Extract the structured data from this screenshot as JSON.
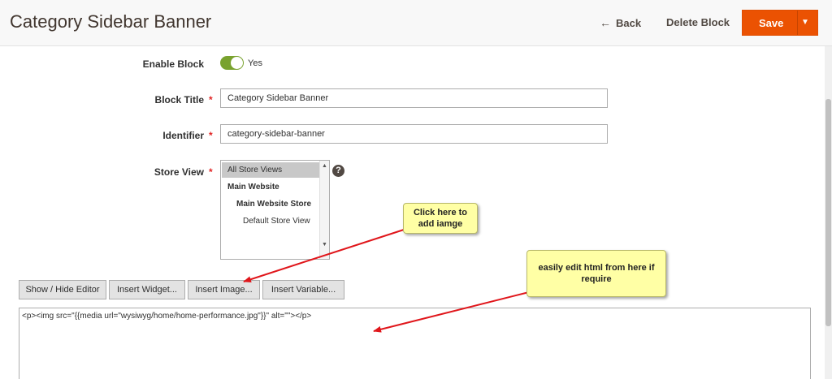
{
  "header": {
    "title": "Category Sidebar Banner",
    "back_label": "Back",
    "delete_label": "Delete Block",
    "save_label": "Save"
  },
  "form": {
    "enable": {
      "label": "Enable Block",
      "value_text": "Yes",
      "enabled": true
    },
    "title": {
      "label": "Block Title",
      "value": "Category Sidebar Banner"
    },
    "identifier": {
      "label": "Identifier",
      "value": "category-sidebar-banner"
    },
    "store_view": {
      "label": "Store View",
      "options": [
        {
          "label": "All Store Views",
          "selected": true
        },
        {
          "label": "Main Website",
          "selected": false
        },
        {
          "label": "Main Website Store",
          "selected": false
        },
        {
          "label": "Default Store View",
          "selected": false
        }
      ]
    }
  },
  "editor": {
    "buttons": {
      "show_hide": "Show / Hide Editor",
      "insert_widget": "Insert Widget...",
      "insert_image": "Insert Image...",
      "insert_variable": "Insert Variable..."
    },
    "content": "<p><img src=\"{{media url=\"wysiwyg/home/home-performance.jpg\"}}\" alt=\"\"></p>"
  },
  "annotations": {
    "image_hint": "Click here to add iamge",
    "html_hint": "easily edit html from here if require"
  },
  "colors": {
    "accent": "#eb5202",
    "toggle_on": "#79a22e",
    "arrow": "#e0161b",
    "callout_bg": "#ffffa5"
  }
}
